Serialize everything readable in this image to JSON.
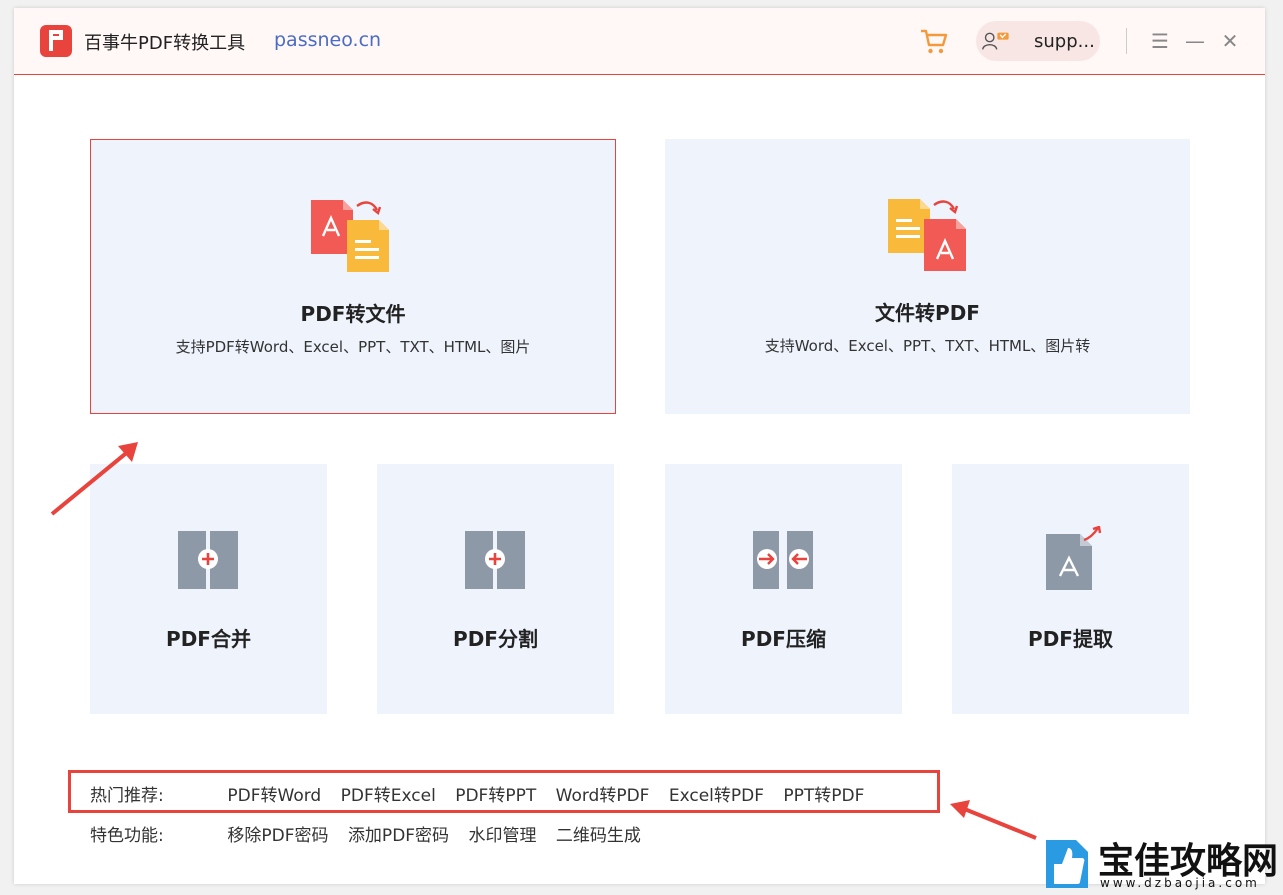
{
  "app": {
    "title": "百事牛PDF转换工具",
    "site": "passneo.cn",
    "user": "supp..."
  },
  "window_controls": {
    "menu_glyph": "☰",
    "minimize_glyph": "—",
    "close_glyph": "✕"
  },
  "cards": {
    "pdf_to_file": {
      "title": "PDF转文件",
      "desc": "支持PDF转Word、Excel、PPT、TXT、HTML、图片"
    },
    "file_to_pdf": {
      "title": "文件转PDF",
      "desc": "支持Word、Excel、PPT、TXT、HTML、图片转"
    },
    "merge": {
      "title": "PDF合并"
    },
    "split": {
      "title": "PDF分割"
    },
    "compress": {
      "title": "PDF压缩"
    },
    "extract": {
      "title": "PDF提取"
    }
  },
  "hot": {
    "label": "热门推荐:",
    "items": [
      "PDF转Word",
      "PDF转Excel",
      "PDF转PPT",
      "Word转PDF",
      "Excel转PDF",
      "PPT转PDF"
    ]
  },
  "features": {
    "label": "特色功能:",
    "items": [
      "移除PDF密码",
      "添加PDF密码",
      "水印管理",
      "二维码生成"
    ]
  },
  "watermark": {
    "text": "宝佳攻略网",
    "url": "www.dzbaojia.com"
  },
  "colors": {
    "accent": "#e8433c",
    "card_bg": "#eef3fc",
    "link": "#4a6cc4",
    "icon_gray": "#8e99a8",
    "doc_yellow": "#f9b93a"
  }
}
